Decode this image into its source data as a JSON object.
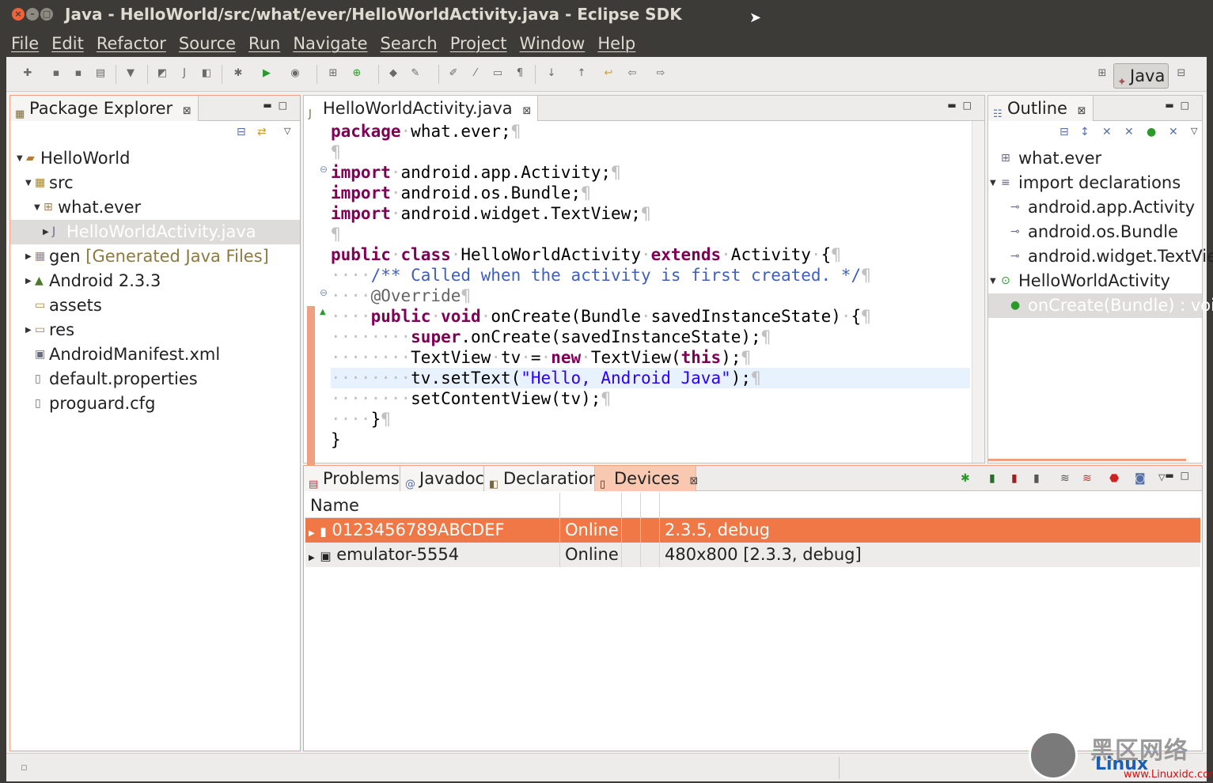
{
  "window": {
    "title": "Java - HelloWorld/src/what/ever/HelloWorldActivity.java - Eclipse SDK"
  },
  "menu": [
    "File",
    "Edit",
    "Refactor",
    "Source",
    "Run",
    "Navigate",
    "Search",
    "Project",
    "Window",
    "Help"
  ],
  "perspective": {
    "label": "Java"
  },
  "package_explorer": {
    "tab_label": "Package Explorer",
    "items": [
      {
        "label": "HelloWorld",
        "icon": "project-icon",
        "level": 0,
        "expanded": true
      },
      {
        "label": "src",
        "icon": "source-folder-icon",
        "level": 1,
        "expanded": true
      },
      {
        "label": "what.ever",
        "icon": "package-icon",
        "level": 2,
        "expanded": true
      },
      {
        "label": "HelloWorldActivity.java",
        "icon": "java-file-icon",
        "level": 3,
        "expanded": false,
        "selected": true
      },
      {
        "label": "gen",
        "decoration": "[Generated Java Files]",
        "icon": "source-folder-icon",
        "level": 1
      },
      {
        "label": "Android 2.3.3",
        "icon": "library-icon",
        "level": 1
      },
      {
        "label": "assets",
        "icon": "folder-icon",
        "level": 1
      },
      {
        "label": "res",
        "icon": "folder-icon",
        "level": 1
      },
      {
        "label": "AndroidManifest.xml",
        "icon": "xml-file-icon",
        "level": 1
      },
      {
        "label": "default.properties",
        "icon": "file-icon",
        "level": 1
      },
      {
        "label": "proguard.cfg",
        "icon": "file-icon",
        "level": 1
      }
    ]
  },
  "editor": {
    "tab_label": "HelloWorldActivity.java",
    "lines": [
      "package what.ever;",
      "",
      "import android.app.Activity;",
      "import android.os.Bundle;",
      "import android.widget.TextView;",
      "",
      "public class HelloWorldActivity extends Activity {",
      "    /** Called when the activity is first created. */",
      "    @Override",
      "    public void onCreate(Bundle savedInstanceState) {",
      "        super.onCreate(savedInstanceState);",
      "        TextView tv = new TextView(this);",
      "        tv.setText(\"Hello, Android Java\");",
      "        setContentView(tv);",
      "    }",
      "}"
    ],
    "highlighted_line": 13
  },
  "outline": {
    "tab_label": "Outline",
    "items": [
      {
        "label": "what.ever",
        "icon": "package-icon"
      },
      {
        "label": "import declarations",
        "icon": "imports-icon"
      },
      {
        "label": "android.app.Activity",
        "icon": "import-icon"
      },
      {
        "label": "android.os.Bundle",
        "icon": "import-icon"
      },
      {
        "label": "android.widget.TextVie",
        "icon": "import-icon"
      },
      {
        "label": "HelloWorldActivity",
        "icon": "class-icon"
      },
      {
        "label": "onCreate(Bundle) : voic",
        "icon": "method-icon",
        "selected": true
      }
    ]
  },
  "bottom_panel": {
    "tabs": [
      "Problems",
      "Javadoc",
      "Declaration",
      "Devices"
    ],
    "active_tab": "Devices",
    "columns": [
      "Name",
      "",
      "",
      "",
      ""
    ],
    "rows": [
      {
        "name": "0123456789ABCDEF",
        "state": "Online",
        "info": "2.3.5, debug",
        "icon": "phone-icon",
        "selected": true
      },
      {
        "name": "emulator-5554",
        "state": "Online",
        "info": "480x800 [2.3.3, debug]",
        "icon": "emulator-icon",
        "selected": false
      }
    ]
  },
  "watermark": {
    "line1": "黑区网络",
    "line2": "Linux",
    "line3": "www.Linuxidc.com"
  },
  "colors": {
    "selection": "#f07846",
    "active_border": "#f0a080",
    "keyword": "#7f0055",
    "comment": "#3f5fbf",
    "string": "#2a00ff"
  }
}
